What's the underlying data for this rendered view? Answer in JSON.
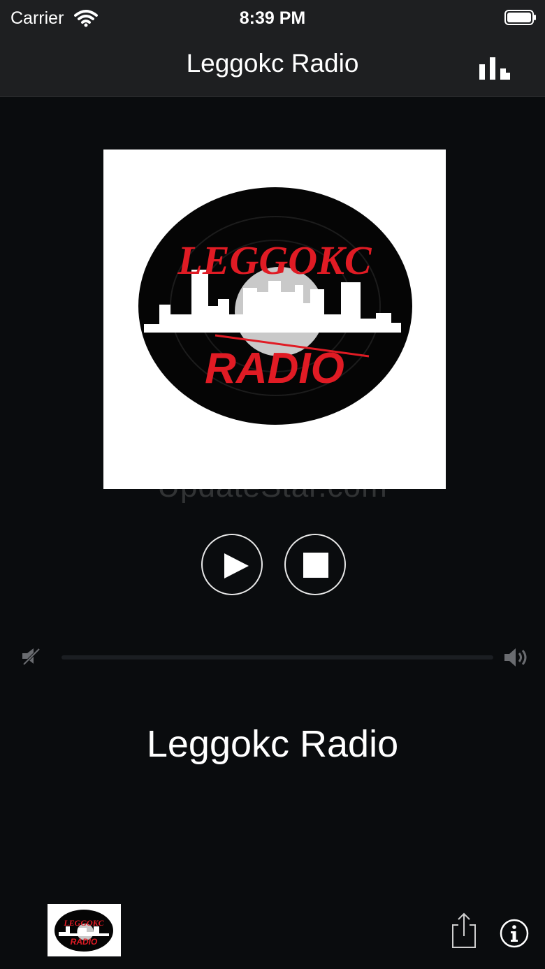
{
  "status": {
    "carrier": "Carrier",
    "time": "8:39 PM"
  },
  "nav": {
    "title": "Leggokc Radio",
    "right_icon": "equalizer-bars-icon"
  },
  "artwork": {
    "logo_top": "LEGGOKC",
    "logo_bottom": "RADIO"
  },
  "watermark": "UpdateStar.com",
  "controls": {
    "play_icon": "play-icon",
    "stop_icon": "stop-icon"
  },
  "volume": {
    "level": 0
  },
  "station": {
    "name": "Leggokc Radio"
  },
  "thumbnail": {
    "logo_top": "LEGGOKC",
    "logo_bottom": "RADIO"
  },
  "colors": {
    "background": "#0a0c0e",
    "bar": "#1e1f21",
    "logo_red": "#e01b24"
  }
}
